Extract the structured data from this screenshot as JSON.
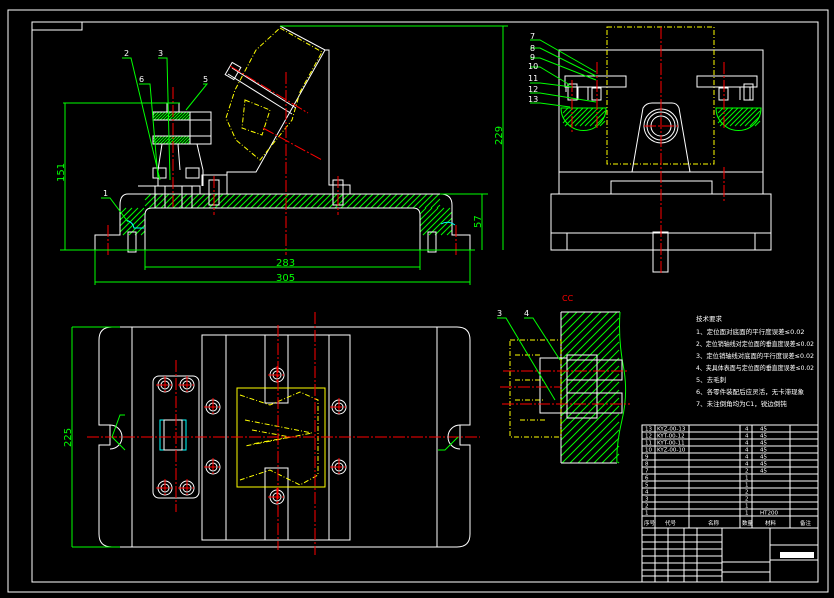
{
  "colors": {
    "background": "#000000",
    "outline": "#ffffff",
    "dimension": "#00ff00",
    "centerline": "#ff0000",
    "workpiece": "#ffff00",
    "section": "#00ffff"
  },
  "front_view": {
    "part_labels": [
      "1",
      "2",
      "3",
      "5",
      "6"
    ],
    "dimensions": {
      "height_151": "151",
      "height_229": "229",
      "height_57": "57",
      "width_283": "283",
      "width_305": "305"
    }
  },
  "side_view": {
    "part_labels": [
      "7",
      "8",
      "9",
      "10",
      "11",
      "12",
      "13"
    ]
  },
  "plan_view": {
    "dimensions": {
      "height_225": "225"
    }
  },
  "section_view": {
    "title": "CC",
    "part_labels": [
      "3",
      "4"
    ]
  },
  "notes": {
    "title": "技术要求",
    "items": [
      "1、定位面对底面的平行度误差≤0.02",
      "2、定位销轴线对定位面的垂直度误差≤0.02",
      "3、定位销轴线对底面的平行度误差≤0.02",
      "4、夹具体表面与定位面的垂直度误差≤0.02",
      "5、去毛刺",
      "6、各零件装配后应灵活，无卡滞现象",
      "7、未注倒角均为C1，锐边倒钝"
    ]
  },
  "parts_table": {
    "rows": [
      {
        "no": "13",
        "code": "KYZ-00-13",
        "qty": "4",
        "material": "45"
      },
      {
        "no": "12",
        "code": "KYT-00-12",
        "qty": "4",
        "material": "45"
      },
      {
        "no": "11",
        "code": "KYT-00-11",
        "qty": "4",
        "material": "45"
      },
      {
        "no": "10",
        "code": "KYZ-00-10",
        "qty": "4",
        "material": "45"
      },
      {
        "no": "9",
        "code": "",
        "qty": "4",
        "material": "45"
      },
      {
        "no": "8",
        "code": "",
        "qty": "4",
        "material": "45"
      },
      {
        "no": "7",
        "code": "",
        "qty": "2",
        "material": "45"
      },
      {
        "no": "6",
        "code": "",
        "qty": "1",
        "material": ""
      },
      {
        "no": "5",
        "code": "",
        "qty": "1",
        "material": ""
      },
      {
        "no": "4",
        "code": "",
        "qty": "2",
        "material": ""
      },
      {
        "no": "3",
        "code": "",
        "qty": "2",
        "material": ""
      },
      {
        "no": "2",
        "code": "",
        "qty": "1",
        "material": ""
      },
      {
        "no": "1",
        "code": "",
        "qty": "1",
        "material": "HT200"
      }
    ],
    "headers": {
      "no": "序号",
      "code": "代号",
      "name": "名称",
      "qty": "数量",
      "material": "材料",
      "remark": "备注"
    }
  }
}
